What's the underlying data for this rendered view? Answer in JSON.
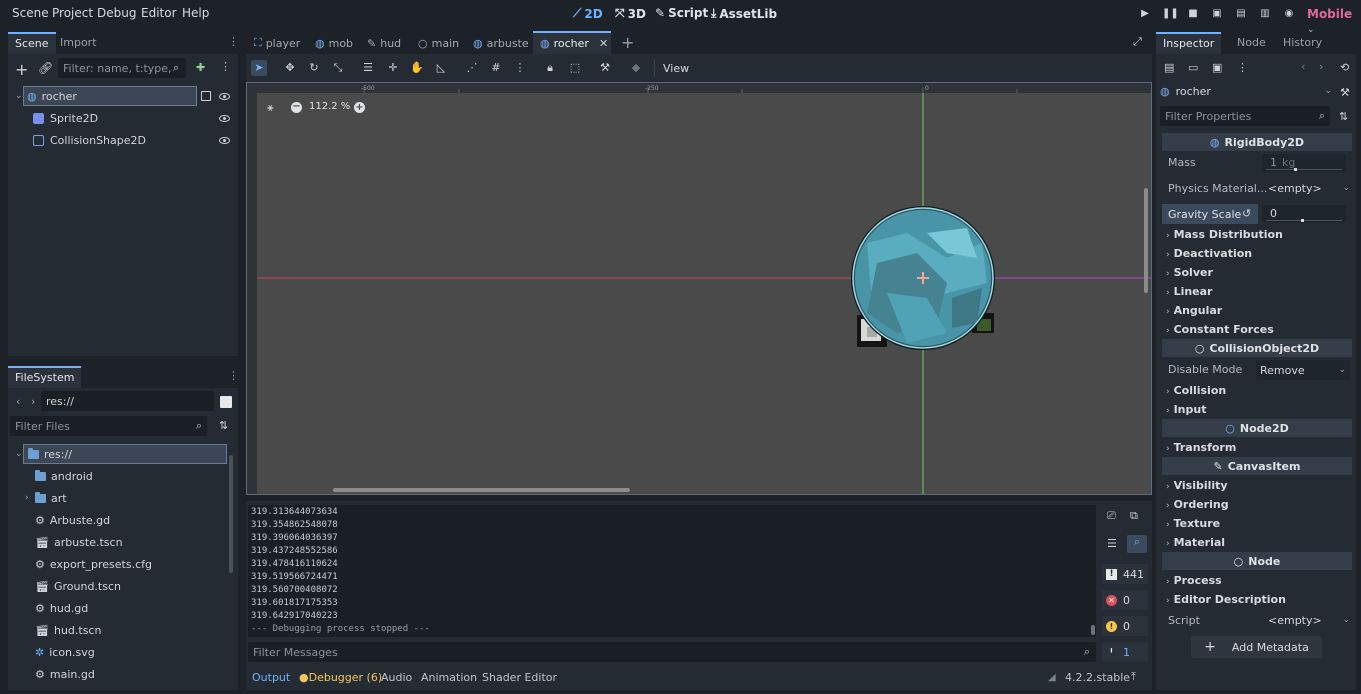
{
  "menubar": {
    "items": [
      "Scene",
      "Project",
      "Debug",
      "Editor",
      "Help"
    ],
    "modes": [
      {
        "label": "2D",
        "icon": "2d-icon",
        "active": true
      },
      {
        "label": "3D",
        "icon": "3d-icon",
        "active": false
      },
      {
        "label": "Script",
        "icon": "script-icon",
        "active": false
      },
      {
        "label": "AssetLib",
        "icon": "assetlib-icon",
        "active": false
      }
    ],
    "renderer": "Mobile"
  },
  "scene_dock": {
    "tabs": [
      "Scene",
      "Import"
    ],
    "filter_placeholder": "Filter: name, t:type, g:",
    "nodes": [
      {
        "label": "rocher",
        "icon": "rigidbody-icon"
      },
      {
        "label": "Sprite2D",
        "icon": "sprite-icon"
      },
      {
        "label": "CollisionShape2D",
        "icon": "collision-shape-icon"
      }
    ]
  },
  "filesystem": {
    "tab": "FileSystem",
    "path": "res://",
    "filter_placeholder": "Filter Files",
    "items": [
      {
        "label": "res://",
        "icon": "folder-icon"
      },
      {
        "label": "android",
        "icon": "folder-icon"
      },
      {
        "label": "art",
        "icon": "folder-icon"
      },
      {
        "label": "Arbuste.gd",
        "icon": "gear-icon"
      },
      {
        "label": "arbuste.tscn",
        "icon": "scene-icon"
      },
      {
        "label": "export_presets.cfg",
        "icon": "config-icon"
      },
      {
        "label": "Ground.tscn",
        "icon": "scene-icon"
      },
      {
        "label": "hud.gd",
        "icon": "gear-icon"
      },
      {
        "label": "hud.tscn",
        "icon": "scene-icon"
      },
      {
        "label": "icon.svg",
        "icon": "image-icon"
      },
      {
        "label": "main.gd",
        "icon": "gear-icon"
      }
    ]
  },
  "editor_tabs": [
    {
      "label": "player",
      "icon": "rigidbody-icon"
    },
    {
      "label": "mob",
      "icon": "rigidbody-icon"
    },
    {
      "label": "hud",
      "icon": "canvas-icon"
    },
    {
      "label": "main",
      "icon": "node-icon"
    },
    {
      "label": "arbuste",
      "icon": "rigidbody-icon"
    },
    {
      "label": "rocher",
      "icon": "rigidbody-icon",
      "active": true
    }
  ],
  "toolbar": {
    "view_label": "View"
  },
  "viewport": {
    "zoom": "112.2 %",
    "ruler_labels": [
      "-500",
      "-250",
      "0"
    ]
  },
  "inspector": {
    "tabs": [
      "Inspector",
      "Node",
      "History"
    ],
    "object": "rocher",
    "filter_placeholder": "Filter Properties",
    "rigidbody_header": "RigidBody2D",
    "mass_label": "Mass",
    "mass_value": "1",
    "mass_unit": "kg",
    "physics_material_label": "Physics Material...",
    "physics_material_value": "<empty>",
    "gravity_scale_label": "Gravity Scale",
    "gravity_scale_value": "0",
    "sections1": [
      "Mass Distribution",
      "Deactivation",
      "Solver",
      "Linear",
      "Angular",
      "Constant Forces"
    ],
    "collision_object_header": "CollisionObject2D",
    "disable_mode_label": "Disable Mode",
    "disable_mode_value": "Remove",
    "sections2": [
      "Collision",
      "Input"
    ],
    "node2d_header": "Node2D",
    "sections3": [
      "Transform"
    ],
    "canvasitem_header": "CanvasItem",
    "sections4": [
      "Visibility",
      "Ordering",
      "Texture",
      "Material"
    ],
    "node_header": "Node",
    "sections5": [
      "Process",
      "Editor Description"
    ],
    "script_label": "Script",
    "script_value": "<empty>",
    "add_metadata": "Add Metadata"
  },
  "console": {
    "lines": [
      "319.313644073634",
      "319.354862548078",
      "319.396064036397",
      "319.437248552586",
      "319.478416110624",
      "319.519566724471",
      "319.560700408072",
      "319.601817175353",
      "319.642917040223",
      "--- Debugging process stopped ---"
    ],
    "filter_placeholder": "Filter Messages",
    "counts": {
      "messages": "441",
      "errors": "0",
      "warnings": "0",
      "info": "1"
    }
  },
  "bottom_tabs": [
    "Output",
    "Debugger (6)",
    "Audio",
    "Animation",
    "Shader Editor"
  ],
  "version": "4.2.2.stable",
  "colors": {
    "accent": "#6fb1ff",
    "background": "#1d2229",
    "panel": "#252b33",
    "viewport": "#4a4a4a"
  }
}
